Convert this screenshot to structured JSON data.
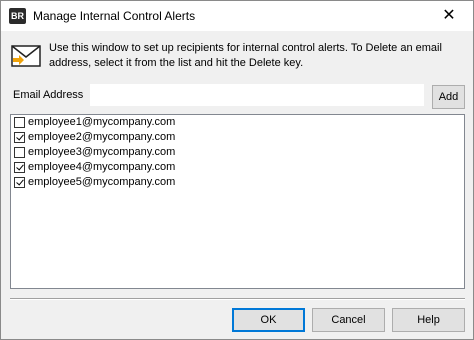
{
  "window": {
    "title": "Manage Internal Control Alerts",
    "app_icon_text": "BR",
    "close_glyph": "✕"
  },
  "info": {
    "text": "Use this window to set up recipients for internal control alerts. To Delete an email address, select it from the list and hit the Delete key.",
    "icon": "envelope-icon"
  },
  "email": {
    "label": "Email Address",
    "value": "",
    "placeholder": "",
    "add_label": "Add"
  },
  "recipients": [
    {
      "email": "employee1@mycompany.com",
      "checked": false
    },
    {
      "email": "employee2@mycompany.com",
      "checked": true
    },
    {
      "email": "employee3@mycompany.com",
      "checked": false
    },
    {
      "email": "employee4@mycompany.com",
      "checked": true
    },
    {
      "email": "employee5@mycompany.com",
      "checked": true
    }
  ],
  "buttons": {
    "ok": "OK",
    "cancel": "Cancel",
    "help": "Help"
  },
  "colors": {
    "accent": "#0078d7",
    "envelope_arrow": "#f0a30a"
  }
}
